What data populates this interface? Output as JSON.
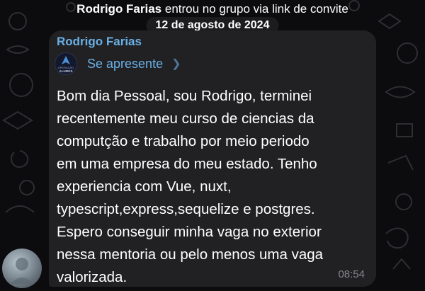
{
  "colors": {
    "background": "#0c0c0e",
    "bubble": "#212123",
    "accent": "#6bb0e6",
    "text": "#ffffff",
    "timestamp": "#86868c"
  },
  "system_notice": {
    "user": "Rodrigo Farias",
    "text": "entrou no grupo via link de convite"
  },
  "date_separator": "12 de agosto de 2024",
  "message": {
    "sender": "Rodrigo Farias",
    "topic": {
      "label": "Se apresente",
      "icon": "operacao-alunos-logo",
      "logo_text": "ALUNOS",
      "logo_subtext": "OPERAÇÃO"
    },
    "text": "Bom dia Pessoal, sou Rodrigo, terminei\nrecentemente meu curso de ciencias da\ncomputção e trabalho por meio periodo\nem uma empresa do meu estado. Tenho\nexperiencia com Vue, nuxt,\ntypescript,express,sequelize e postgres.\nEspero conseguir minha vaga no exterior\nnessa mentoria ou pelo menos uma vaga\nvalorizada.",
    "time": "08:54"
  },
  "avatar": {
    "icon": "user-avatar-blurred"
  }
}
